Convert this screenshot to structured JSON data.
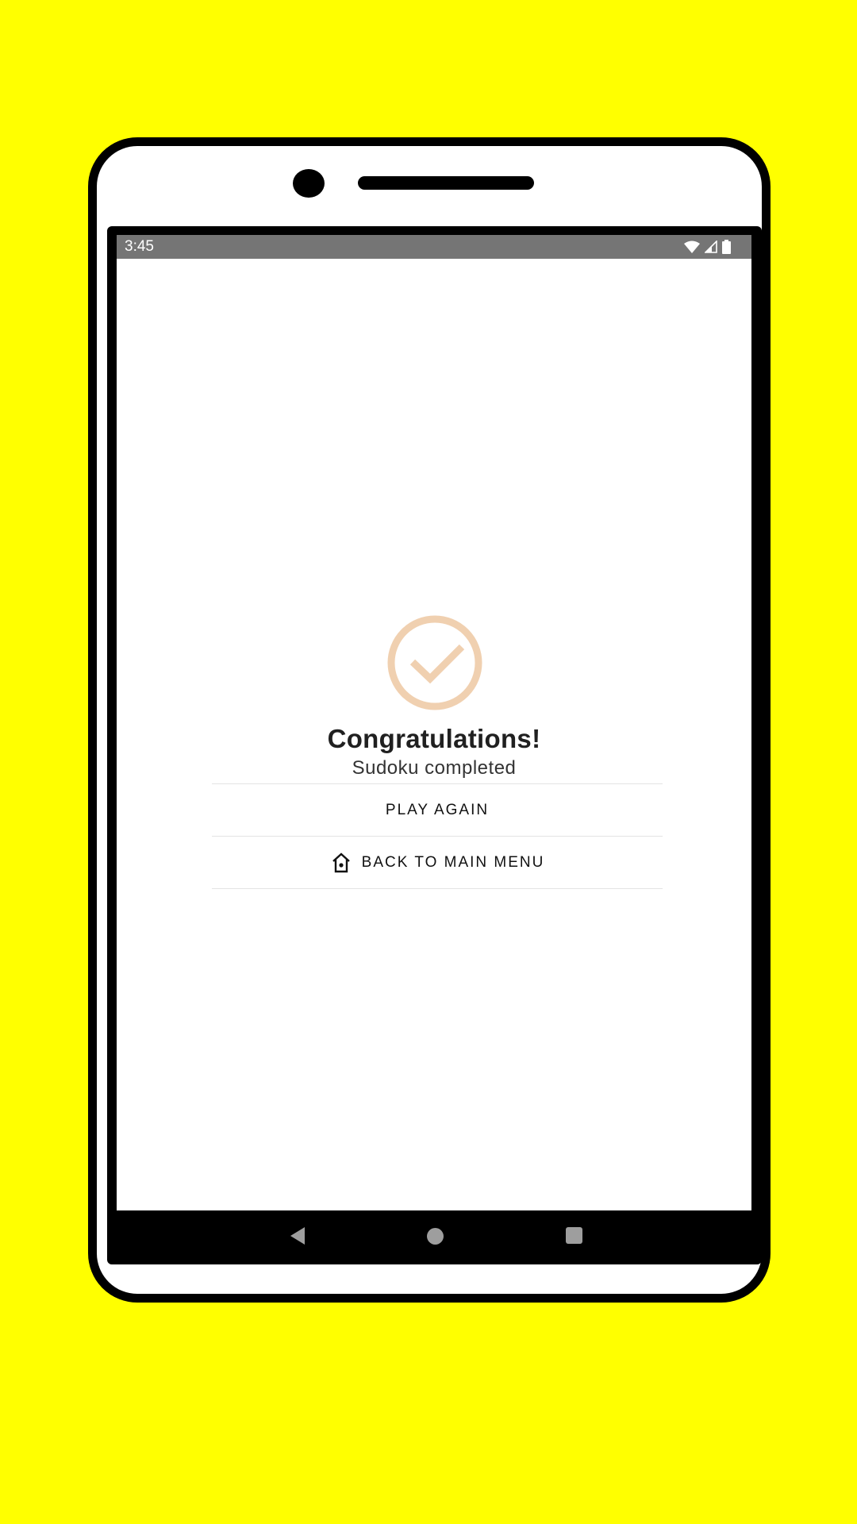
{
  "status_bar": {
    "time": "3:45",
    "icons": [
      "wifi-icon",
      "cell-signal-icon",
      "battery-icon"
    ]
  },
  "completion": {
    "icon": "check-circle-icon",
    "icon_color": "#f0d0b0",
    "title": "Congratulations!",
    "subtitle": "Sudoku completed"
  },
  "menu": {
    "play_again_label": "PLAY AGAIN",
    "back_to_menu_label": "BACK TO MAIN MENU",
    "back_to_menu_icon": "home-icon"
  },
  "navigation": {
    "icons": [
      "back-icon",
      "home-circle-icon",
      "recents-icon"
    ]
  },
  "colors": {
    "background": "#ffff00",
    "status_bar": "#757575",
    "accent": "#f0d0b0"
  }
}
